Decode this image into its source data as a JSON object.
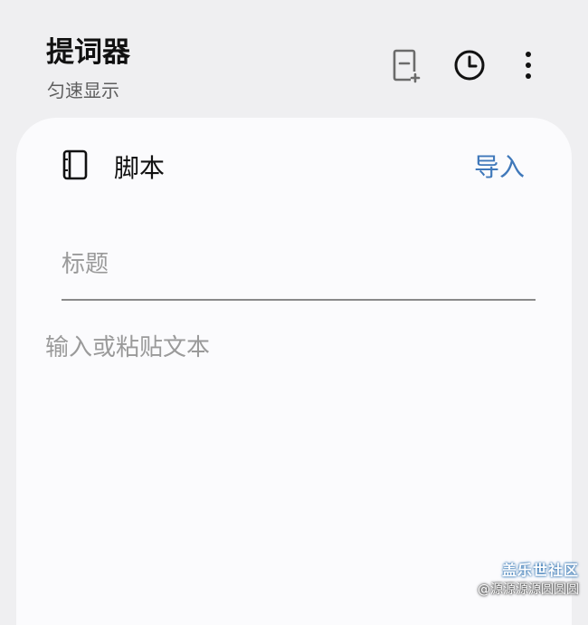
{
  "header": {
    "title": "提词器",
    "subtitle": "匀速显示",
    "icons": [
      "new-page-icon",
      "history-clock-icon",
      "more-vertical-icon"
    ]
  },
  "card": {
    "section_label": "脚本",
    "section_icon": "notebook-icon",
    "import_label": "导入",
    "title_placeholder": "标题",
    "title_value": "",
    "body_placeholder": "输入或粘贴文本",
    "body_value": ""
  },
  "watermark": {
    "brand": "盖乐世社区",
    "user": "@源源源源圆圆圆"
  },
  "colors": {
    "background": "#efeff1",
    "card": "#fbfbfd",
    "accent": "#3f78ba",
    "placeholder": "#9a9a9a"
  }
}
